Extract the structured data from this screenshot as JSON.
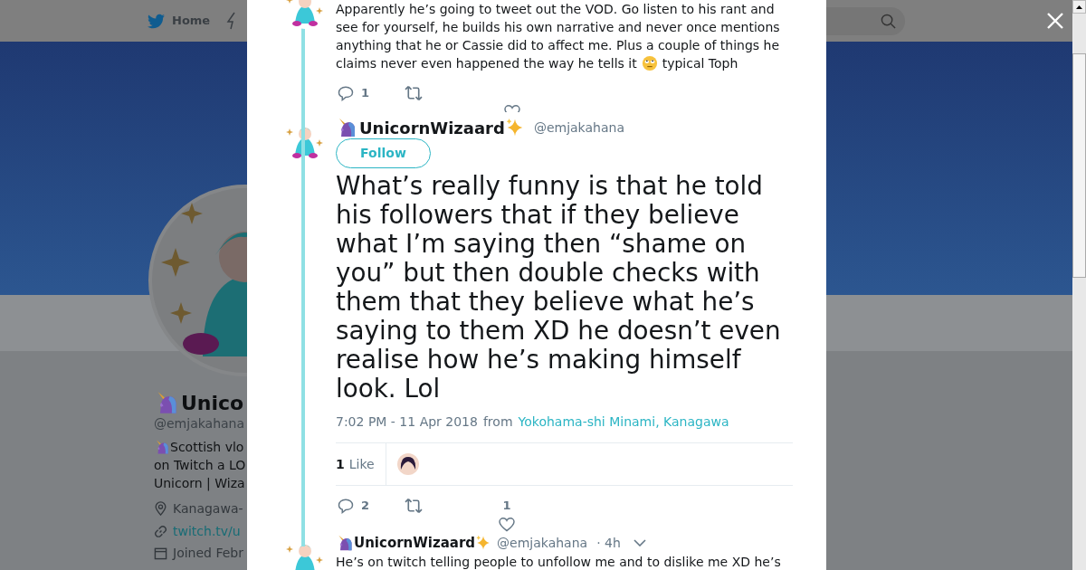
{
  "background_page": {
    "nav": {
      "home_label": "Home"
    },
    "profile": {
      "name": "Unico",
      "handle": "@emjakahana",
      "bio_lines": [
        "Scottish vlo",
        "on Twitch a LO",
        "Unicorn | Wiza"
      ],
      "location": "Kanagawa-",
      "link": "twitch.tv/u",
      "joined": "Joined Febr"
    }
  },
  "thread": {
    "previous_tweet": {
      "text": "Apparently he’s going to tweet out the VOD. Go listen to his rant and see for yourself, he builds his own narrative and never once mentions anything that he or Cassie did to affect me. Plus a couple of things he",
      "text_last_line": "claims never even happened the way he tells it",
      "text_end": "typical Toph",
      "reply_count": "1"
    },
    "main_tweet": {
      "name": "UnicornWizaard",
      "handle": "@emjakahana",
      "follow_label": "Follow",
      "text": "What’s really funny is that he told his followers that if they believe what I’m saying then “shame on you” but then double checks with them that they believe what he’s saying to them XD he doesn’t even realise how he’s making himself look. Lol",
      "time": "7:02 PM - 11 Apr 2018",
      "from_label": "from",
      "location": "Yokohama-shi Minami, Kanagawa",
      "likes_count": "1",
      "likes_label": "Like",
      "reply_count": "2",
      "like_count": "1"
    },
    "next_tweet": {
      "name": "UnicornWizaard",
      "handle": "@emjakahana",
      "age": "· 4h",
      "text": "He’s on twitch telling people to unfollow me and to dislike me XD he’s"
    }
  }
}
